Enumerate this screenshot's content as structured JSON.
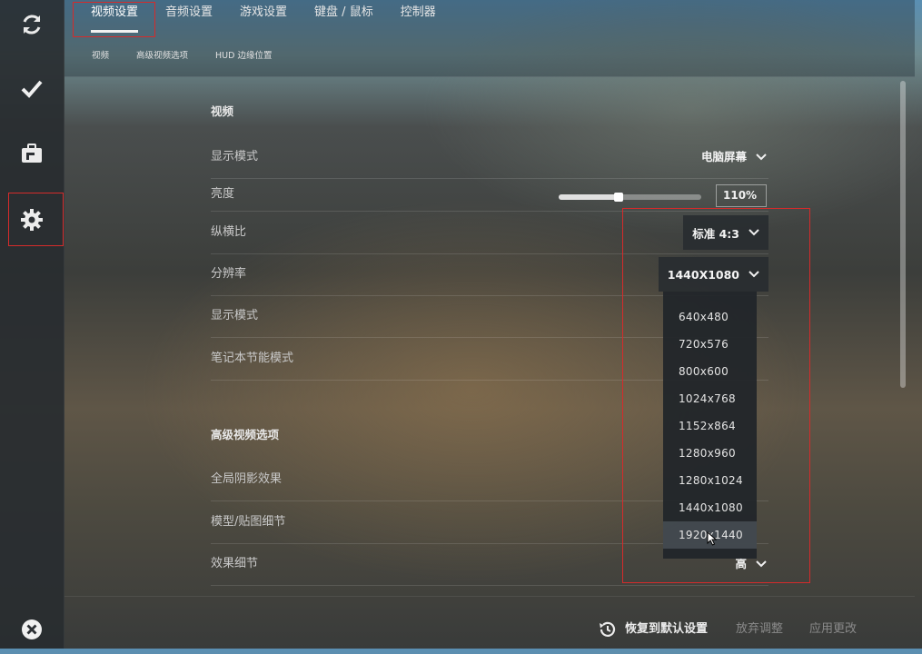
{
  "nav_tabs": [
    "视频设置",
    "音频设置",
    "游戏设置",
    "键盘 / 鼠标",
    "控制器"
  ],
  "sub_tabs": [
    "视频",
    "高级视频选项",
    "HUD 边缘位置"
  ],
  "sidebar_icons": [
    "refresh-icon",
    "check-icon",
    "briefcase-icon",
    "gear-icon",
    "close-icon"
  ],
  "section_video": "视频",
  "rows": {
    "display_mode": {
      "label": "显示模式",
      "value": "电脑屏幕"
    },
    "brightness": {
      "label": "亮度",
      "value": "110%",
      "level": 0.42
    },
    "aspect_ratio": {
      "label": "纵横比",
      "value": "标准 4:3"
    },
    "resolution": {
      "label": "分辨率",
      "value": "1440X1080"
    },
    "display_mode2": {
      "label": "显示模式"
    },
    "laptop_power": {
      "label": "笔记本节能模式"
    }
  },
  "section_advanced": "高级视频选项",
  "adv_rows": {
    "shadow": {
      "label": "全局阴影效果"
    },
    "model_detail": {
      "label": "模型/贴图细节"
    },
    "effect_detail": {
      "label": "效果细节",
      "value": "高"
    }
  },
  "resolution_options": [
    "640x480",
    "720x576",
    "800x600",
    "1024x768",
    "1152x864",
    "1280x960",
    "1280x1024",
    "1440x1080",
    "1920x1440"
  ],
  "footer": {
    "restore": "恢复到默认设置",
    "discard": "放弃调整",
    "apply": "应用更改"
  },
  "colors": {
    "highlight_box": "#d52b2b"
  }
}
